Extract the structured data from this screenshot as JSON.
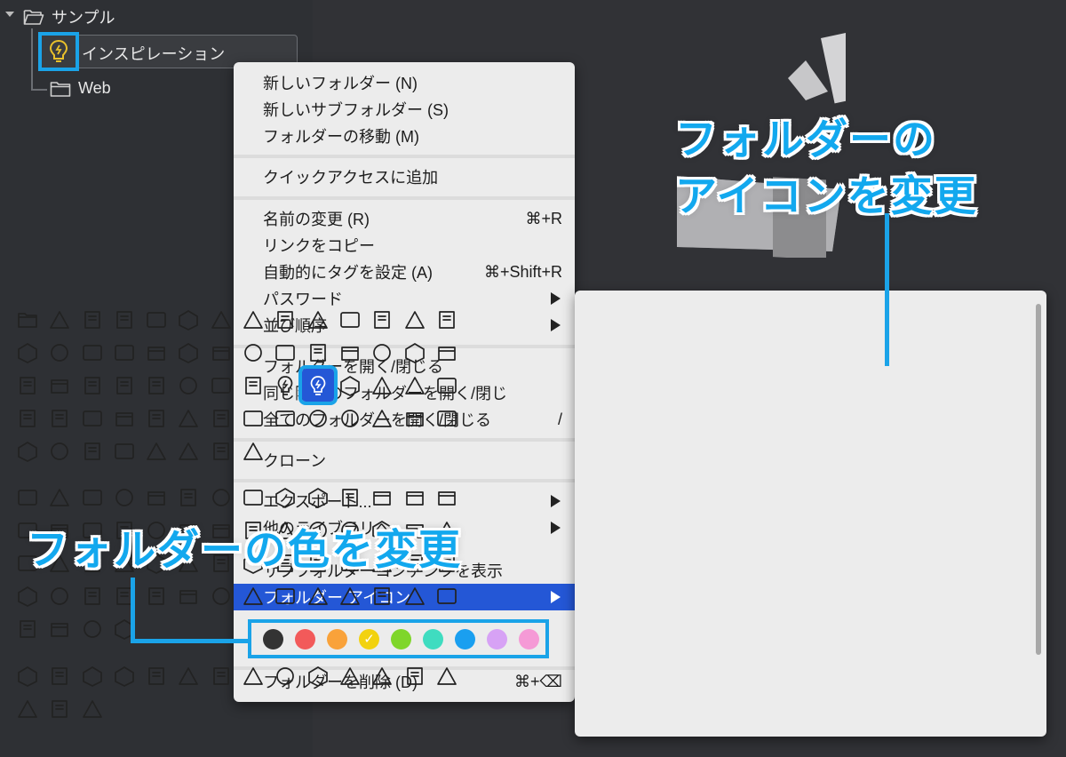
{
  "sidebar": {
    "root_label": "サンプル",
    "child_selected_label": "インスピレーション",
    "child_web_label": "Web"
  },
  "menu": {
    "items": [
      {
        "label": "新しいフォルダー (N)"
      },
      {
        "label": "新しいサブフォルダー (S)"
      },
      {
        "label": "フォルダーの移動 (M)"
      },
      {
        "label": "クイックアクセスに追加"
      },
      {
        "label": "名前の変更 (R)",
        "shortcut": "⌘+R"
      },
      {
        "label": "リンクをコピー"
      },
      {
        "label": "自動的にタグを設定 (A)",
        "shortcut": "⌘+Shift+R"
      },
      {
        "label": "パスワード"
      },
      {
        "label": "並び順序"
      },
      {
        "label": "フォルダーを開く/閉じる"
      },
      {
        "label": "同じ階層のフォルダーを開く/閉じ"
      },
      {
        "label": "全てのフォルダーを開く/閉じる",
        "shortcut": "/"
      },
      {
        "label": "クローン"
      },
      {
        "label": "エクスポート..."
      },
      {
        "label": "他のライブラリへ"
      },
      {
        "label": "サブフォルダーコンテンツを表示"
      },
      {
        "label": "フォルダー アイコン"
      },
      {
        "label": "フォルダーを削除 (D)",
        "shortcut": "⌘+⌫"
      }
    ],
    "colors": [
      "#333333",
      "#f25a5a",
      "#f9a23a",
      "#f2d20f",
      "#7fd62a",
      "#3fdcc0",
      "#1a9ff0",
      "#d7a2f5",
      "#f59ad6"
    ]
  },
  "annotations": {
    "icon_callout_line1": "フォルダーの",
    "icon_callout_line2": "アイコンを変更",
    "color_callout": "フォルダーの色を変更"
  },
  "icon_panel": {
    "section1": [
      "folder",
      "inbox",
      "cube",
      "grid",
      "layers",
      "briefcase",
      "image",
      "photo",
      "play",
      "video",
      "camera-video",
      "film",
      "music",
      "book",
      "book-open",
      "library",
      "presentation",
      "camera",
      "aperture",
      "paperclip",
      "scissors",
      "palette",
      "wrench",
      "bell",
      "lifebuoy",
      "pen-nib",
      "pen",
      "utensils",
      "gear",
      "graduation-cap",
      "cone",
      "basketball",
      "mail",
      "id-card",
      "coffee",
      "cart",
      "bulb",
      "bulb-selected",
      "thumbs-up",
      "thumbs-down",
      "heart",
      "heart-broken",
      "star",
      "fire",
      "upload",
      "download",
      "dollar-doc",
      "dollar-doc2",
      "plus-badge",
      "shield",
      "search",
      "command",
      "recycle",
      "alert",
      "question",
      "dollar",
      "yen",
      "diamond",
      "euro",
      "wallet",
      "watch",
      "clock",
      "calendar-7",
      "calendar-31"
    ],
    "section2": [
      "window",
      "phone",
      "tablet",
      "monitor",
      "tv",
      "chip",
      "compass",
      "chrome",
      "pie-chart",
      "bar-chart",
      "line-chart",
      "2d",
      "3d",
      "contrast",
      "layout",
      "external",
      "shapes",
      "copy",
      "text-ag",
      "text-ag2",
      "text-ag3",
      "flag",
      "globe",
      "map-pin",
      "map-pin-check",
      "map",
      "signpost",
      "alarm",
      "rocket",
      "plane",
      "ship",
      "train",
      "car",
      "truck",
      "drop",
      "sun",
      "moon",
      "leaf",
      "mountain",
      "cloud",
      "bath",
      "door",
      "bed",
      "cabinet",
      "sofa",
      "home",
      "shop",
      "building",
      "gamepad",
      "sword",
      "helmet",
      "badge",
      "medal",
      "ring",
      "crown",
      "trophy",
      "gift",
      "facebook",
      "twitter",
      "instagram"
    ],
    "section3": [
      "eye",
      "bear",
      "dog",
      "cat",
      "user",
      "users",
      "user-group",
      "smile",
      "neutral",
      "sad",
      "skull",
      "laugh",
      "grin",
      "angel",
      "devil",
      "hand",
      "brain"
    ],
    "selected": "bulb-selected"
  }
}
